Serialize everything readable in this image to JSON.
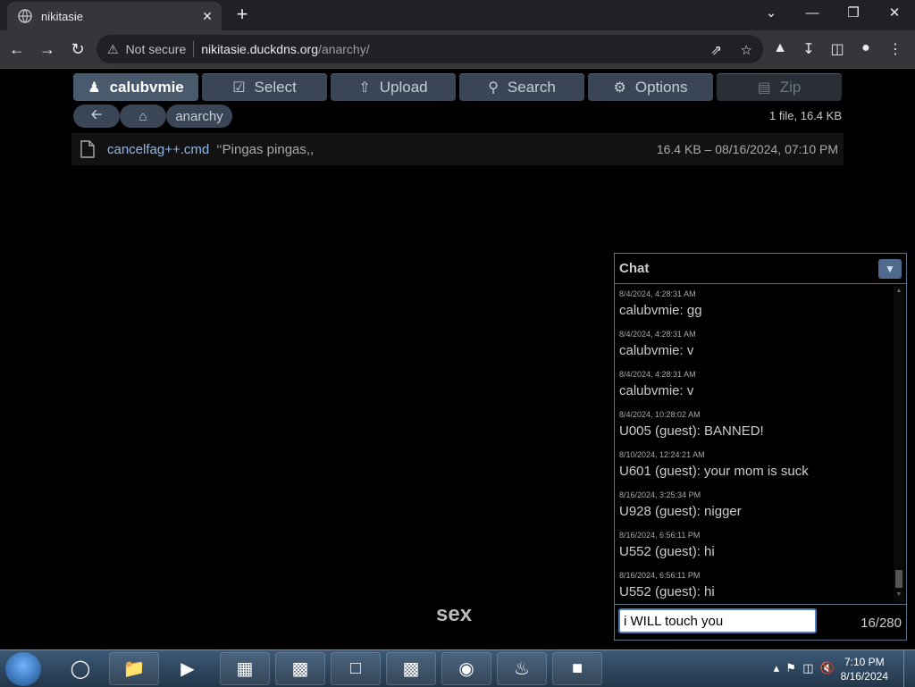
{
  "browser": {
    "tab_title": "nikitasie",
    "tab_close": "✕",
    "new_tab": "+",
    "window_controls": [
      "⌄",
      "—",
      "❐",
      "✕"
    ],
    "security_label": "Not secure",
    "url_host": "nikitasie.duckdns.org",
    "url_path": "/anarchy/"
  },
  "toolbar": {
    "user_label": "calubvmie",
    "select_label": "Select",
    "upload_label": "Upload",
    "search_label": "Search",
    "options_label": "Options",
    "zip_label": "Zip"
  },
  "breadcrumb": {
    "current": "anarchy"
  },
  "summary": "1 file, 16.4 KB",
  "files": [
    {
      "name": "cancelfag++.cmd",
      "description": "‘‘Pingas pingas,,",
      "meta": "16.4 KB – 08/16/2024, 07:10 PM"
    }
  ],
  "overlay_text": "sex",
  "chat": {
    "title": "Chat",
    "messages": [
      {
        "ts": "8/4/2024, 4:28:31 AM",
        "text": "calubvmie: gg"
      },
      {
        "ts": "8/4/2024, 4:28:31 AM",
        "text": "calubvmie: v"
      },
      {
        "ts": "8/4/2024, 4:28:31 AM",
        "text": "calubvmie: v"
      },
      {
        "ts": "8/4/2024, 10:28:02 AM",
        "text": "U005 (guest): BANNED!"
      },
      {
        "ts": "8/10/2024, 12:24:21 AM",
        "text": "U601 (guest): your mom is suck"
      },
      {
        "ts": "8/16/2024, 3:25:34 PM",
        "text": "U928 (guest): nigger"
      },
      {
        "ts": "8/16/2024, 6:56:11 PM",
        "text": "U552 (guest): hi"
      },
      {
        "ts": "8/16/2024, 6:56:11 PM",
        "text": "U552 (guest): hi"
      }
    ],
    "input_value": "i WILL touch you",
    "counter": "16/280"
  },
  "taskbar": {
    "time": "7:10 PM",
    "date": "8/16/2024"
  },
  "colors": {
    "button_bg": "#3a4656",
    "link": "#8fb6e8",
    "chat_border": "#5b6f86"
  }
}
